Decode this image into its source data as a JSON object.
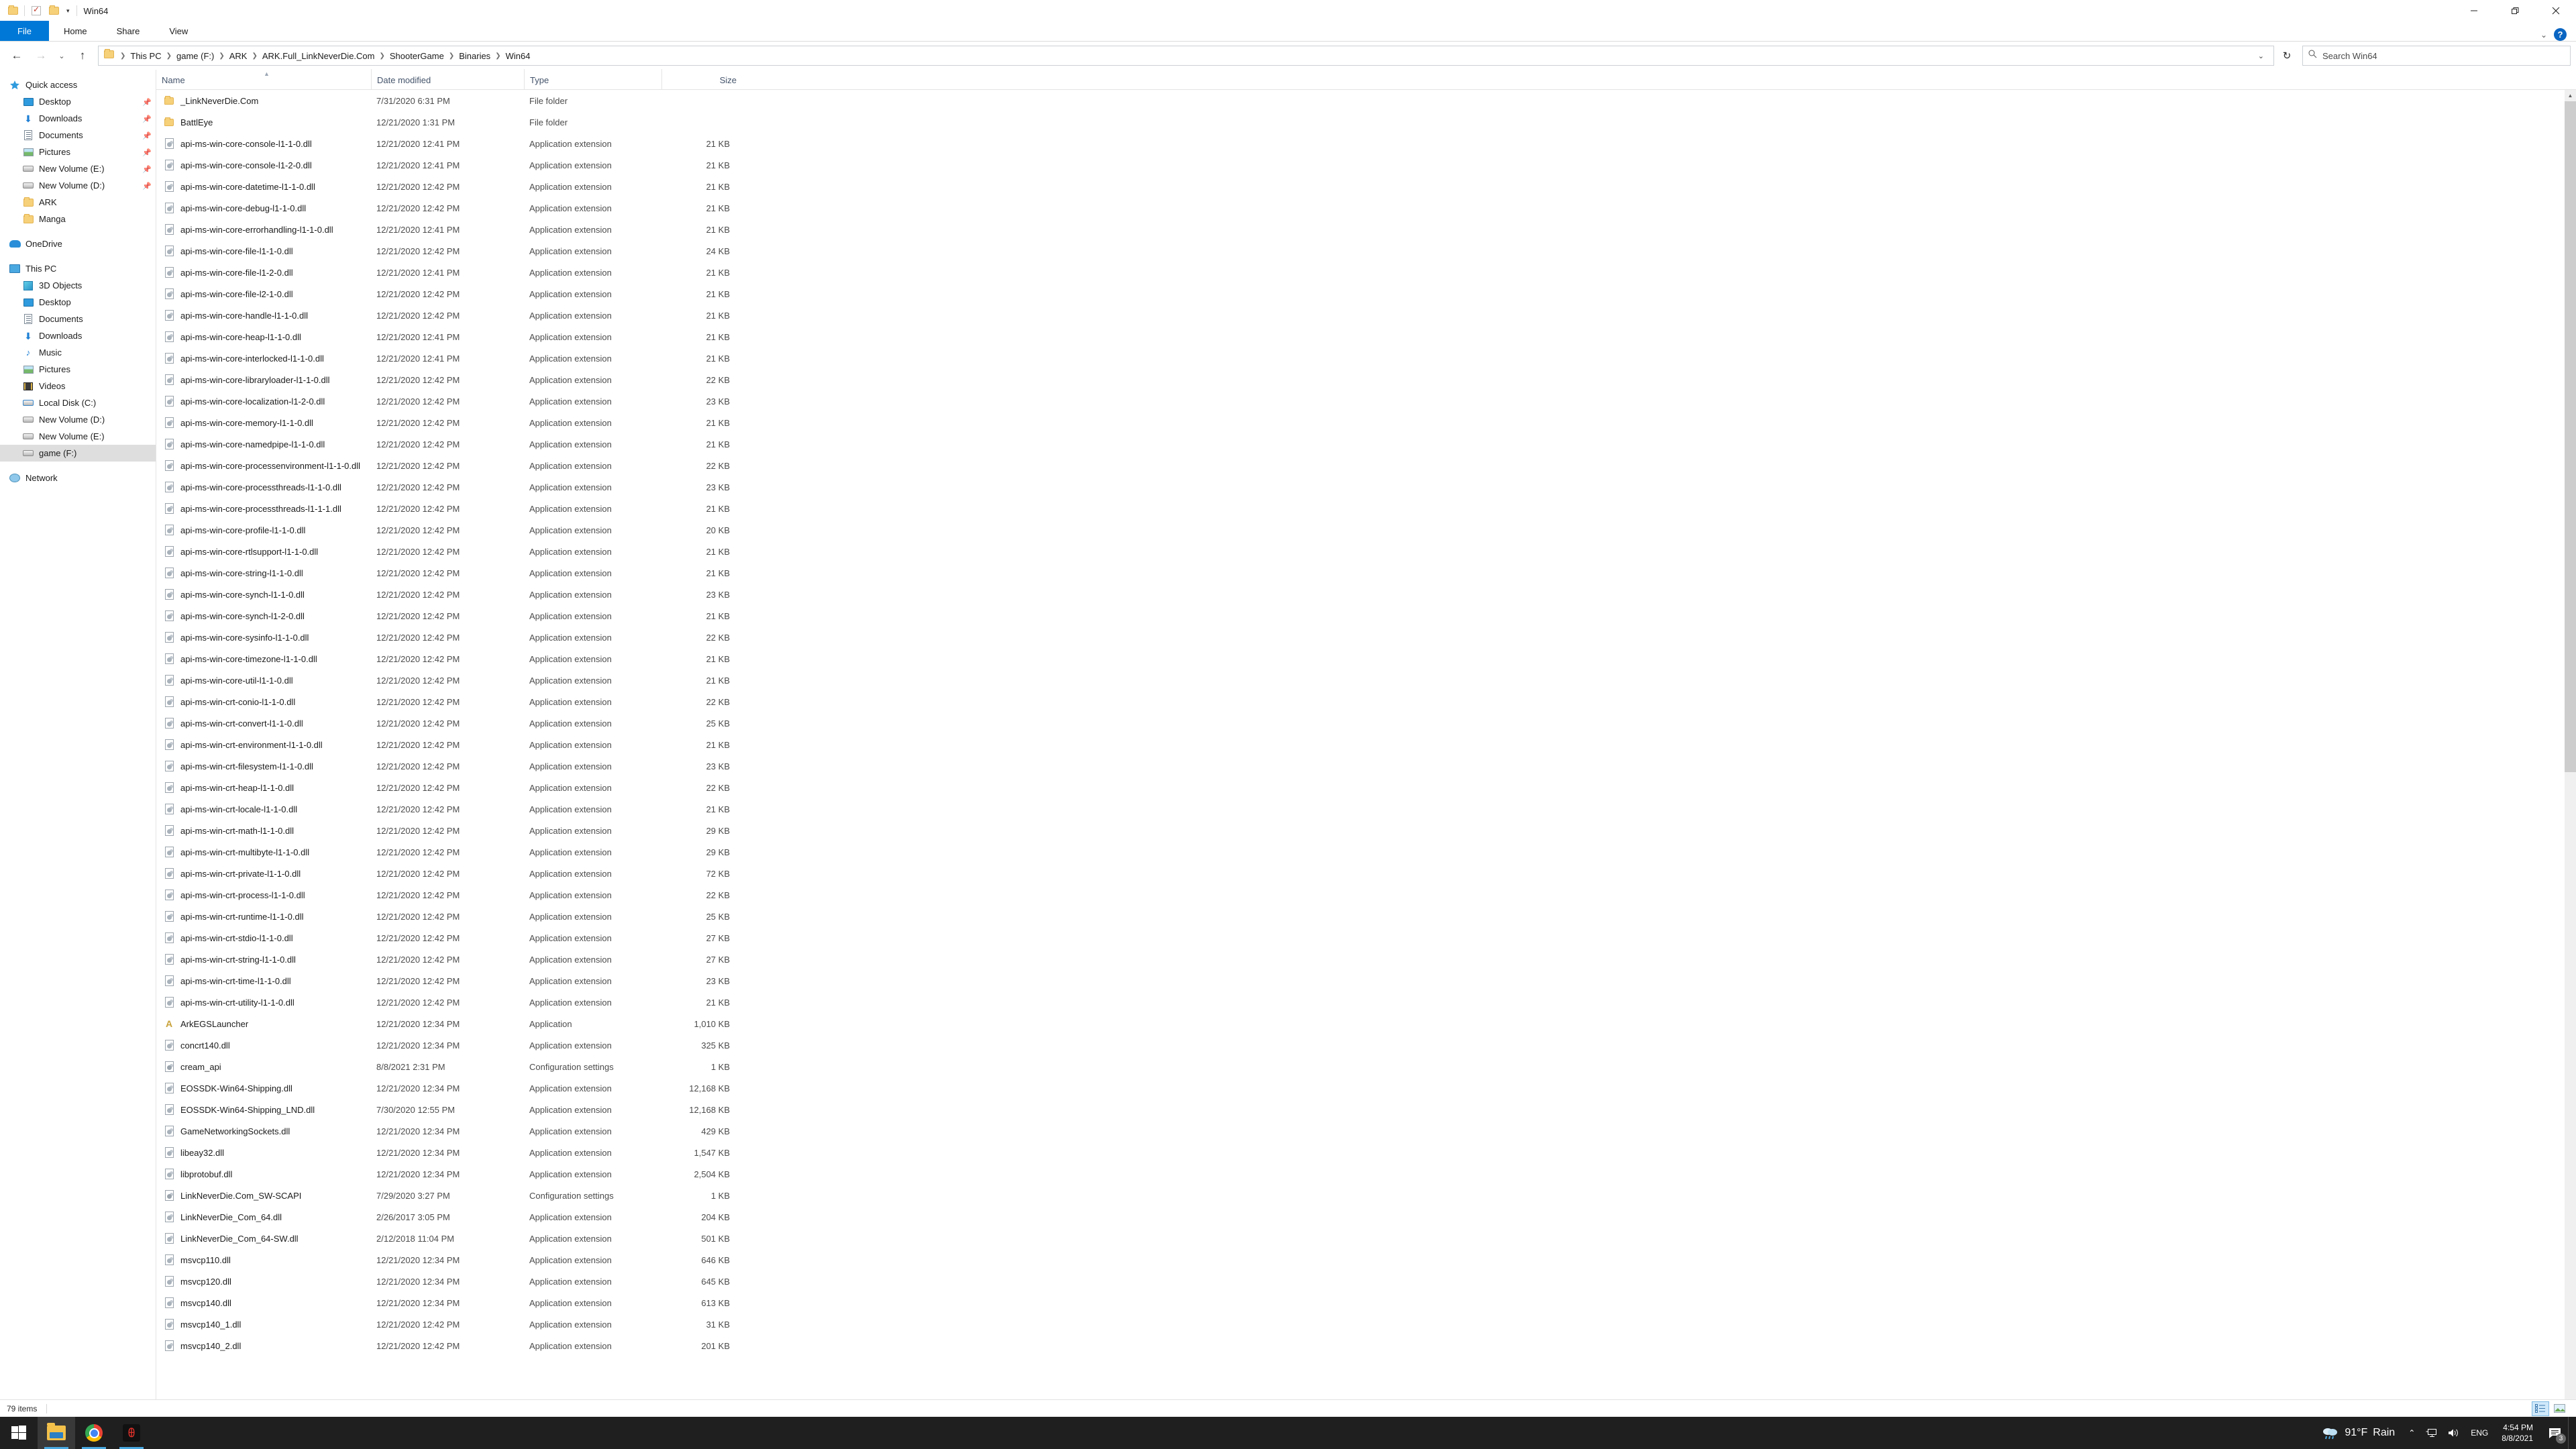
{
  "window": {
    "title": "Win64",
    "quick_access_icons": [
      "folder-icon",
      "properties-checkbox-icon",
      "new-folder-icon",
      "customize-caret-icon"
    ],
    "controls": {
      "minimize": "minimize-icon",
      "restore": "restore-icon",
      "close": "close-icon"
    }
  },
  "ribbon": {
    "tabs": [
      {
        "label": "File",
        "active": true
      },
      {
        "label": "Home",
        "active": false
      },
      {
        "label": "Share",
        "active": false
      },
      {
        "label": "View",
        "active": false
      }
    ],
    "expand_label": "⌄",
    "help_label": "?"
  },
  "address": {
    "back": "←",
    "forward": "→",
    "recent": "⌄",
    "up": "↑",
    "crumbs": [
      "This PC",
      "game (F:)",
      "ARK",
      "ARK.Full_LinkNeverDie.Com",
      "ShooterGame",
      "Binaries",
      "Win64"
    ],
    "dropdown": "⌄",
    "refresh": "↻",
    "search_placeholder": "Search Win64"
  },
  "sidebar": {
    "items": [
      {
        "label": "Quick access",
        "icon": "star-icon",
        "indent": 0,
        "pinned": false,
        "selected": false
      },
      {
        "label": "Desktop",
        "icon": "monitor-icon",
        "indent": 1,
        "pinned": true,
        "selected": false
      },
      {
        "label": "Downloads",
        "icon": "download-icon",
        "indent": 1,
        "pinned": true,
        "selected": false
      },
      {
        "label": "Documents",
        "icon": "document-icon",
        "indent": 1,
        "pinned": true,
        "selected": false
      },
      {
        "label": "Pictures",
        "icon": "picture-icon",
        "indent": 1,
        "pinned": true,
        "selected": false
      },
      {
        "label": "New Volume (E:)",
        "icon": "drive-icon",
        "indent": 1,
        "pinned": true,
        "selected": false
      },
      {
        "label": "New Volume (D:)",
        "icon": "drive-icon",
        "indent": 1,
        "pinned": true,
        "selected": false
      },
      {
        "label": "ARK",
        "icon": "folder-icon",
        "indent": 1,
        "pinned": false,
        "selected": false
      },
      {
        "label": "Manga",
        "icon": "folder-icon",
        "indent": 1,
        "pinned": false,
        "selected": false
      },
      {
        "gap": true
      },
      {
        "label": "OneDrive",
        "icon": "cloud-icon",
        "indent": 0,
        "pinned": false,
        "selected": false
      },
      {
        "gap": true
      },
      {
        "label": "This PC",
        "icon": "pc-icon",
        "indent": 0,
        "pinned": false,
        "selected": false
      },
      {
        "label": "3D Objects",
        "icon": "cube-icon",
        "indent": 1,
        "pinned": false,
        "selected": false
      },
      {
        "label": "Desktop",
        "icon": "monitor-icon",
        "indent": 1,
        "pinned": false,
        "selected": false
      },
      {
        "label": "Documents",
        "icon": "document-icon",
        "indent": 1,
        "pinned": false,
        "selected": false
      },
      {
        "label": "Downloads",
        "icon": "download-icon",
        "indent": 1,
        "pinned": false,
        "selected": false
      },
      {
        "label": "Music",
        "icon": "music-icon",
        "indent": 1,
        "pinned": false,
        "selected": false
      },
      {
        "label": "Pictures",
        "icon": "picture-icon",
        "indent": 1,
        "pinned": false,
        "selected": false
      },
      {
        "label": "Videos",
        "icon": "video-icon",
        "indent": 1,
        "pinned": false,
        "selected": false
      },
      {
        "label": "Local Disk (C:)",
        "icon": "windows-drive-icon",
        "indent": 1,
        "pinned": false,
        "selected": false
      },
      {
        "label": "New Volume (D:)",
        "icon": "drive-icon",
        "indent": 1,
        "pinned": false,
        "selected": false
      },
      {
        "label": "New Volume (E:)",
        "icon": "drive-icon",
        "indent": 1,
        "pinned": false,
        "selected": false
      },
      {
        "label": "game (F:)",
        "icon": "drive-icon",
        "indent": 1,
        "pinned": false,
        "selected": true
      },
      {
        "gap": true
      },
      {
        "label": "Network",
        "icon": "network-icon",
        "indent": 0,
        "pinned": false,
        "selected": false
      }
    ]
  },
  "file_list": {
    "columns": [
      {
        "key": "name",
        "label": "Name",
        "sorted": "asc"
      },
      {
        "key": "date",
        "label": "Date modified",
        "sorted": null
      },
      {
        "key": "type",
        "label": "Type",
        "sorted": null
      },
      {
        "key": "size",
        "label": "Size",
        "sorted": null
      }
    ],
    "rows": [
      {
        "name": "_LinkNeverDie.Com",
        "date": "7/31/2020 6:31 PM",
        "type": "File folder",
        "size": "",
        "icon": "folder-icon"
      },
      {
        "name": "BattlEye",
        "date": "12/21/2020 1:31 PM",
        "type": "File folder",
        "size": "",
        "icon": "folder-icon"
      },
      {
        "name": "api-ms-win-core-console-l1-1-0.dll",
        "date": "12/21/2020 12:41 PM",
        "type": "Application extension",
        "size": "21 KB",
        "icon": "dll-icon"
      },
      {
        "name": "api-ms-win-core-console-l1-2-0.dll",
        "date": "12/21/2020 12:41 PM",
        "type": "Application extension",
        "size": "21 KB",
        "icon": "dll-icon"
      },
      {
        "name": "api-ms-win-core-datetime-l1-1-0.dll",
        "date": "12/21/2020 12:42 PM",
        "type": "Application extension",
        "size": "21 KB",
        "icon": "dll-icon"
      },
      {
        "name": "api-ms-win-core-debug-l1-1-0.dll",
        "date": "12/21/2020 12:42 PM",
        "type": "Application extension",
        "size": "21 KB",
        "icon": "dll-icon"
      },
      {
        "name": "api-ms-win-core-errorhandling-l1-1-0.dll",
        "date": "12/21/2020 12:41 PM",
        "type": "Application extension",
        "size": "21 KB",
        "icon": "dll-icon"
      },
      {
        "name": "api-ms-win-core-file-l1-1-0.dll",
        "date": "12/21/2020 12:42 PM",
        "type": "Application extension",
        "size": "24 KB",
        "icon": "dll-icon"
      },
      {
        "name": "api-ms-win-core-file-l1-2-0.dll",
        "date": "12/21/2020 12:41 PM",
        "type": "Application extension",
        "size": "21 KB",
        "icon": "dll-icon"
      },
      {
        "name": "api-ms-win-core-file-l2-1-0.dll",
        "date": "12/21/2020 12:42 PM",
        "type": "Application extension",
        "size": "21 KB",
        "icon": "dll-icon"
      },
      {
        "name": "api-ms-win-core-handle-l1-1-0.dll",
        "date": "12/21/2020 12:42 PM",
        "type": "Application extension",
        "size": "21 KB",
        "icon": "dll-icon"
      },
      {
        "name": "api-ms-win-core-heap-l1-1-0.dll",
        "date": "12/21/2020 12:41 PM",
        "type": "Application extension",
        "size": "21 KB",
        "icon": "dll-icon"
      },
      {
        "name": "api-ms-win-core-interlocked-l1-1-0.dll",
        "date": "12/21/2020 12:41 PM",
        "type": "Application extension",
        "size": "21 KB",
        "icon": "dll-icon"
      },
      {
        "name": "api-ms-win-core-libraryloader-l1-1-0.dll",
        "date": "12/21/2020 12:42 PM",
        "type": "Application extension",
        "size": "22 KB",
        "icon": "dll-icon"
      },
      {
        "name": "api-ms-win-core-localization-l1-2-0.dll",
        "date": "12/21/2020 12:42 PM",
        "type": "Application extension",
        "size": "23 KB",
        "icon": "dll-icon"
      },
      {
        "name": "api-ms-win-core-memory-l1-1-0.dll",
        "date": "12/21/2020 12:42 PM",
        "type": "Application extension",
        "size": "21 KB",
        "icon": "dll-icon"
      },
      {
        "name": "api-ms-win-core-namedpipe-l1-1-0.dll",
        "date": "12/21/2020 12:42 PM",
        "type": "Application extension",
        "size": "21 KB",
        "icon": "dll-icon"
      },
      {
        "name": "api-ms-win-core-processenvironment-l1-1-0.dll",
        "date": "12/21/2020 12:42 PM",
        "type": "Application extension",
        "size": "22 KB",
        "icon": "dll-icon"
      },
      {
        "name": "api-ms-win-core-processthreads-l1-1-0.dll",
        "date": "12/21/2020 12:42 PM",
        "type": "Application extension",
        "size": "23 KB",
        "icon": "dll-icon"
      },
      {
        "name": "api-ms-win-core-processthreads-l1-1-1.dll",
        "date": "12/21/2020 12:42 PM",
        "type": "Application extension",
        "size": "21 KB",
        "icon": "dll-icon"
      },
      {
        "name": "api-ms-win-core-profile-l1-1-0.dll",
        "date": "12/21/2020 12:42 PM",
        "type": "Application extension",
        "size": "20 KB",
        "icon": "dll-icon"
      },
      {
        "name": "api-ms-win-core-rtlsupport-l1-1-0.dll",
        "date": "12/21/2020 12:42 PM",
        "type": "Application extension",
        "size": "21 KB",
        "icon": "dll-icon"
      },
      {
        "name": "api-ms-win-core-string-l1-1-0.dll",
        "date": "12/21/2020 12:42 PM",
        "type": "Application extension",
        "size": "21 KB",
        "icon": "dll-icon"
      },
      {
        "name": "api-ms-win-core-synch-l1-1-0.dll",
        "date": "12/21/2020 12:42 PM",
        "type": "Application extension",
        "size": "23 KB",
        "icon": "dll-icon"
      },
      {
        "name": "api-ms-win-core-synch-l1-2-0.dll",
        "date": "12/21/2020 12:42 PM",
        "type": "Application extension",
        "size": "21 KB",
        "icon": "dll-icon"
      },
      {
        "name": "api-ms-win-core-sysinfo-l1-1-0.dll",
        "date": "12/21/2020 12:42 PM",
        "type": "Application extension",
        "size": "22 KB",
        "icon": "dll-icon"
      },
      {
        "name": "api-ms-win-core-timezone-l1-1-0.dll",
        "date": "12/21/2020 12:42 PM",
        "type": "Application extension",
        "size": "21 KB",
        "icon": "dll-icon"
      },
      {
        "name": "api-ms-win-core-util-l1-1-0.dll",
        "date": "12/21/2020 12:42 PM",
        "type": "Application extension",
        "size": "21 KB",
        "icon": "dll-icon"
      },
      {
        "name": "api-ms-win-crt-conio-l1-1-0.dll",
        "date": "12/21/2020 12:42 PM",
        "type": "Application extension",
        "size": "22 KB",
        "icon": "dll-icon"
      },
      {
        "name": "api-ms-win-crt-convert-l1-1-0.dll",
        "date": "12/21/2020 12:42 PM",
        "type": "Application extension",
        "size": "25 KB",
        "icon": "dll-icon"
      },
      {
        "name": "api-ms-win-crt-environment-l1-1-0.dll",
        "date": "12/21/2020 12:42 PM",
        "type": "Application extension",
        "size": "21 KB",
        "icon": "dll-icon"
      },
      {
        "name": "api-ms-win-crt-filesystem-l1-1-0.dll",
        "date": "12/21/2020 12:42 PM",
        "type": "Application extension",
        "size": "23 KB",
        "icon": "dll-icon"
      },
      {
        "name": "api-ms-win-crt-heap-l1-1-0.dll",
        "date": "12/21/2020 12:42 PM",
        "type": "Application extension",
        "size": "22 KB",
        "icon": "dll-icon"
      },
      {
        "name": "api-ms-win-crt-locale-l1-1-0.dll",
        "date": "12/21/2020 12:42 PM",
        "type": "Application extension",
        "size": "21 KB",
        "icon": "dll-icon"
      },
      {
        "name": "api-ms-win-crt-math-l1-1-0.dll",
        "date": "12/21/2020 12:42 PM",
        "type": "Application extension",
        "size": "29 KB",
        "icon": "dll-icon"
      },
      {
        "name": "api-ms-win-crt-multibyte-l1-1-0.dll",
        "date": "12/21/2020 12:42 PM",
        "type": "Application extension",
        "size": "29 KB",
        "icon": "dll-icon"
      },
      {
        "name": "api-ms-win-crt-private-l1-1-0.dll",
        "date": "12/21/2020 12:42 PM",
        "type": "Application extension",
        "size": "72 KB",
        "icon": "dll-icon"
      },
      {
        "name": "api-ms-win-crt-process-l1-1-0.dll",
        "date": "12/21/2020 12:42 PM",
        "type": "Application extension",
        "size": "22 KB",
        "icon": "dll-icon"
      },
      {
        "name": "api-ms-win-crt-runtime-l1-1-0.dll",
        "date": "12/21/2020 12:42 PM",
        "type": "Application extension",
        "size": "25 KB",
        "icon": "dll-icon"
      },
      {
        "name": "api-ms-win-crt-stdio-l1-1-0.dll",
        "date": "12/21/2020 12:42 PM",
        "type": "Application extension",
        "size": "27 KB",
        "icon": "dll-icon"
      },
      {
        "name": "api-ms-win-crt-string-l1-1-0.dll",
        "date": "12/21/2020 12:42 PM",
        "type": "Application extension",
        "size": "27 KB",
        "icon": "dll-icon"
      },
      {
        "name": "api-ms-win-crt-time-l1-1-0.dll",
        "date": "12/21/2020 12:42 PM",
        "type": "Application extension",
        "size": "23 KB",
        "icon": "dll-icon"
      },
      {
        "name": "api-ms-win-crt-utility-l1-1-0.dll",
        "date": "12/21/2020 12:42 PM",
        "type": "Application extension",
        "size": "21 KB",
        "icon": "dll-icon"
      },
      {
        "name": "ArkEGSLauncher",
        "date": "12/21/2020 12:34 PM",
        "type": "Application",
        "size": "1,010 KB",
        "icon": "application-icon"
      },
      {
        "name": "concrt140.dll",
        "date": "12/21/2020 12:34 PM",
        "type": "Application extension",
        "size": "325 KB",
        "icon": "dll-icon"
      },
      {
        "name": "cream_api",
        "date": "8/8/2021 2:31 PM",
        "type": "Configuration settings",
        "size": "1 KB",
        "icon": "config-icon"
      },
      {
        "name": "EOSSDK-Win64-Shipping.dll",
        "date": "12/21/2020 12:34 PM",
        "type": "Application extension",
        "size": "12,168 KB",
        "icon": "dll-icon"
      },
      {
        "name": "EOSSDK-Win64-Shipping_LND.dll",
        "date": "7/30/2020 12:55 PM",
        "type": "Application extension",
        "size": "12,168 KB",
        "icon": "dll-icon"
      },
      {
        "name": "GameNetworkingSockets.dll",
        "date": "12/21/2020 12:34 PM",
        "type": "Application extension",
        "size": "429 KB",
        "icon": "dll-icon"
      },
      {
        "name": "libeay32.dll",
        "date": "12/21/2020 12:34 PM",
        "type": "Application extension",
        "size": "1,547 KB",
        "icon": "dll-icon"
      },
      {
        "name": "libprotobuf.dll",
        "date": "12/21/2020 12:34 PM",
        "type": "Application extension",
        "size": "2,504 KB",
        "icon": "dll-icon"
      },
      {
        "name": "LinkNeverDie.Com_SW-SCAPI",
        "date": "7/29/2020 3:27 PM",
        "type": "Configuration settings",
        "size": "1 KB",
        "icon": "config-icon"
      },
      {
        "name": "LinkNeverDie_Com_64.dll",
        "date": "2/26/2017 3:05 PM",
        "type": "Application extension",
        "size": "204 KB",
        "icon": "dll-icon"
      },
      {
        "name": "LinkNeverDie_Com_64-SW.dll",
        "date": "2/12/2018 11:04 PM",
        "type": "Application extension",
        "size": "501 KB",
        "icon": "dll-icon"
      },
      {
        "name": "msvcp110.dll",
        "date": "12/21/2020 12:34 PM",
        "type": "Application extension",
        "size": "646 KB",
        "icon": "dll-icon"
      },
      {
        "name": "msvcp120.dll",
        "date": "12/21/2020 12:34 PM",
        "type": "Application extension",
        "size": "645 KB",
        "icon": "dll-icon"
      },
      {
        "name": "msvcp140.dll",
        "date": "12/21/2020 12:34 PM",
        "type": "Application extension",
        "size": "613 KB",
        "icon": "dll-icon"
      },
      {
        "name": "msvcp140_1.dll",
        "date": "12/21/2020 12:42 PM",
        "type": "Application extension",
        "size": "31 KB",
        "icon": "dll-icon"
      },
      {
        "name": "msvcp140_2.dll",
        "date": "12/21/2020 12:42 PM",
        "type": "Application extension",
        "size": "201 KB",
        "icon": "dll-icon"
      }
    ]
  },
  "status": {
    "item_count": "79 items",
    "view_details": "details-view-icon",
    "view_large": "large-icons-view-icon"
  },
  "taskbar": {
    "start": "windows-start-icon",
    "apps": [
      {
        "name": "file-explorer",
        "active": true
      },
      {
        "name": "google-chrome",
        "active": false
      },
      {
        "name": "garena",
        "active": false
      }
    ],
    "tray": {
      "weather_temp": "91°F",
      "weather_cond": "Rain",
      "overflow": "⌃",
      "network": "network-icon",
      "volume": "volume-icon",
      "language": "ENG",
      "time": "4:54 PM",
      "date": "8/8/2021",
      "notification_count": "3"
    }
  }
}
